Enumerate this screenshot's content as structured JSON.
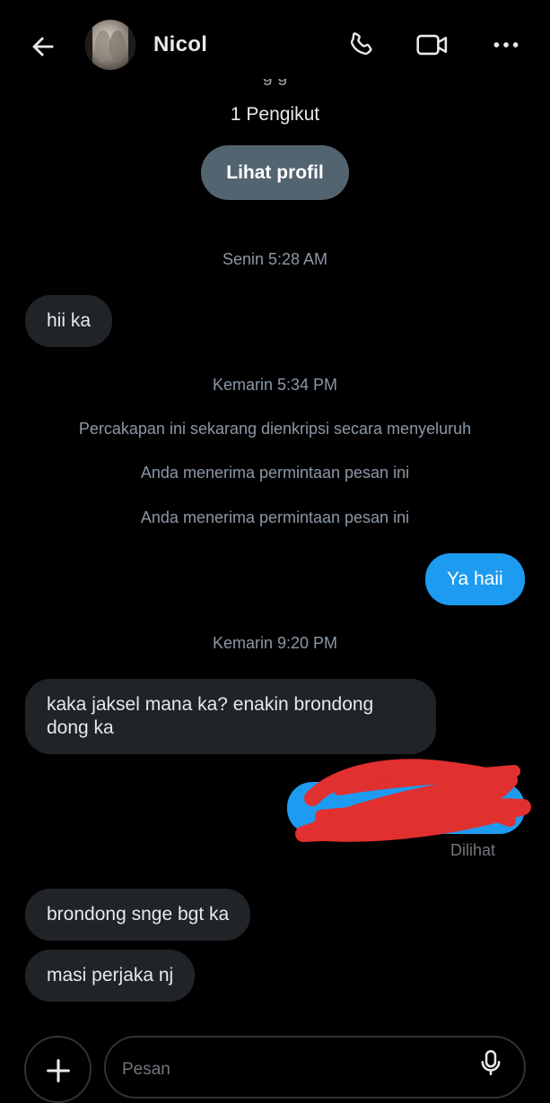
{
  "header": {
    "contact_name": "Nicol",
    "back_icon": "arrow-left-icon",
    "call_icon": "phone-icon",
    "video_icon": "video-camera-icon",
    "more_icon": "more-horizontal-icon"
  },
  "profile": {
    "cut_text": "g   g",
    "followers": "1 Pengikut",
    "view_profile_label": "Lihat profil"
  },
  "conversation": {
    "timestamp_1": "Senin 5:28 AM",
    "msg_1": "hii ka",
    "timestamp_2": "Kemarin 5:34 PM",
    "system_1": "Percakapan ini sekarang dienkripsi secara menyeluruh",
    "system_2": "Anda menerima permintaan pesan ini",
    "system_3": "Anda menerima permintaan pesan ini",
    "msg_2": "Ya haii",
    "timestamp_3": "Kemarin 9:20 PM",
    "msg_3": "kaka jaksel mana ka? enakin brondong dong ka",
    "msg_4_redacted": "",
    "read_status": "Dilihat",
    "msg_5": "brondong snge bgt ka",
    "msg_6": "masi perjaka nj"
  },
  "composer": {
    "placeholder": "Pesan",
    "add_icon": "plus-icon",
    "mic_icon": "microphone-icon"
  },
  "colors": {
    "background": "#000000",
    "incoming_bubble": "#202327",
    "outgoing_bubble": "#1d9bf0",
    "profile_button": "#536471",
    "redaction": "#e0302f"
  }
}
